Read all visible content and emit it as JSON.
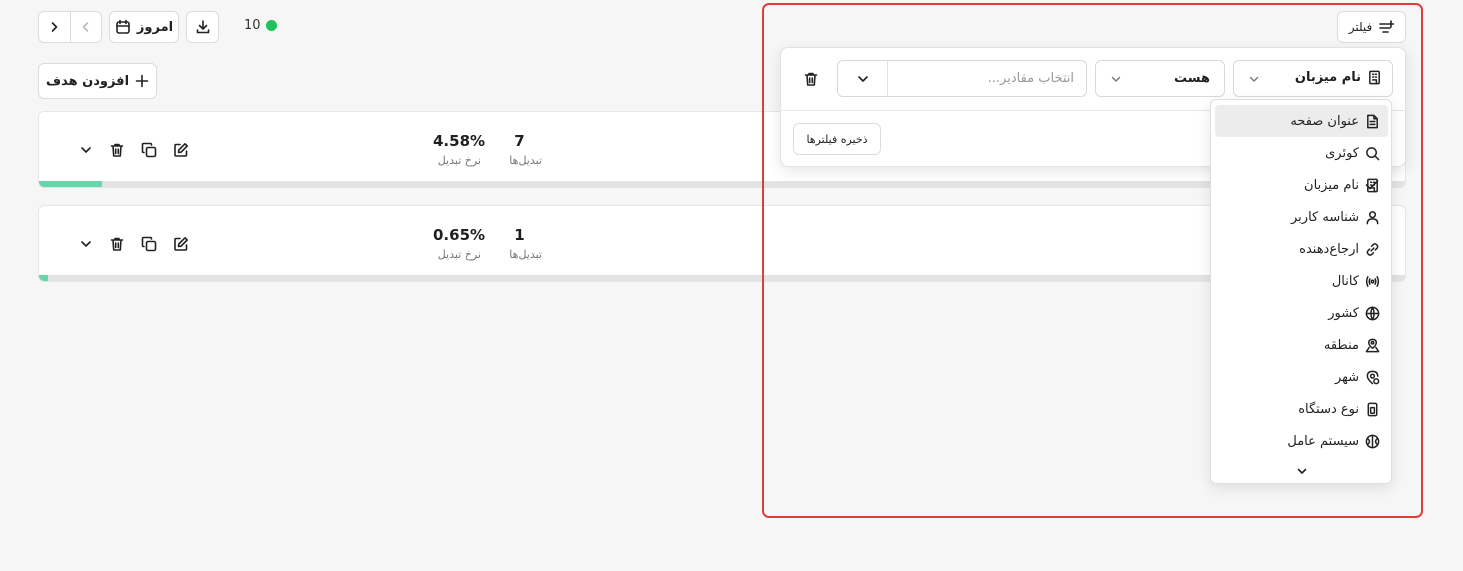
{
  "toolbar": {
    "today_label": "امروز",
    "live_count": "10",
    "filter_label": "فیلتر",
    "add_goal_label": "افزودن هدف"
  },
  "goals": [
    {
      "conversions": "7",
      "conversions_label": "تبدیل‌ها",
      "rate": "4.58%",
      "rate_label": "نرخ تبدیل",
      "progress": 0.0458
    },
    {
      "conversions": "1",
      "conversions_label": "تبدیل‌ها",
      "rate": "0.65%",
      "rate_label": "نرخ تبدیل",
      "progress": 0.0065
    }
  ],
  "filter": {
    "field_value": "نام میزبان",
    "operator_value": "هست",
    "values_placeholder": "انتخاب مقادیر...",
    "save_label": "ذخیره فیلترها"
  },
  "menu": {
    "items": [
      {
        "label": "عنوان صفحه",
        "icon": "file-text-icon",
        "highlighted": true,
        "checked": false
      },
      {
        "label": "کوئری",
        "icon": "search-icon",
        "highlighted": false,
        "checked": false
      },
      {
        "label": "نام میزبان",
        "icon": "building-icon",
        "highlighted": false,
        "checked": true
      },
      {
        "label": "شناسه کاربر",
        "icon": "user-icon",
        "highlighted": false,
        "checked": false
      },
      {
        "label": "ارجاع‌دهنده",
        "icon": "link-icon",
        "highlighted": false,
        "checked": false
      },
      {
        "label": "کانال",
        "icon": "broadcast-icon",
        "highlighted": false,
        "checked": false
      },
      {
        "label": "کشور",
        "icon": "globe-icon",
        "highlighted": false,
        "checked": false
      },
      {
        "label": "منطقه",
        "icon": "map-pin-area-icon",
        "highlighted": false,
        "checked": false
      },
      {
        "label": "شهر",
        "icon": "map-pin-icon",
        "highlighted": false,
        "checked": false
      },
      {
        "label": "نوع دستگاه",
        "icon": "device-icon",
        "highlighted": false,
        "checked": false
      },
      {
        "label": "سیستم عامل",
        "icon": "os-icon",
        "highlighted": false,
        "checked": false
      }
    ]
  },
  "colors": {
    "live_dot": "#1fc15c",
    "progress": "#64d6a7",
    "highlight_frame": "#e03c3c"
  }
}
